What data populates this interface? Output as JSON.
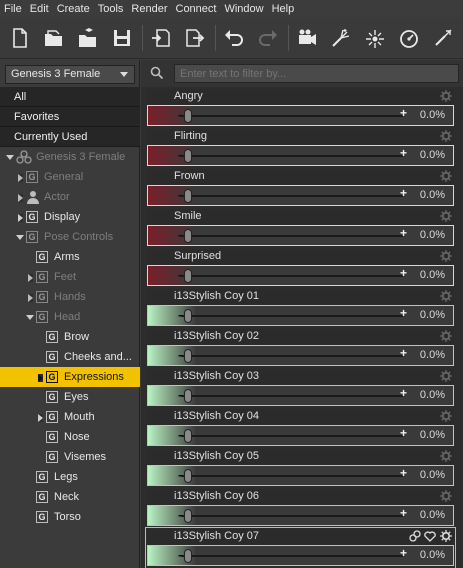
{
  "menu": [
    "File",
    "Edit",
    "Create",
    "Tools",
    "Render",
    "Connect",
    "Window",
    "Help"
  ],
  "toolbar": [
    {
      "name": "new-file-icon"
    },
    {
      "name": "open-folder-icon"
    },
    {
      "name": "merge-folder-icon"
    },
    {
      "name": "save-icon"
    },
    {
      "name": "import-icon"
    },
    {
      "name": "export-icon"
    },
    {
      "name": "undo-icon"
    },
    {
      "name": "redo-icon"
    },
    {
      "name": "camera-icon"
    },
    {
      "name": "spotlight-icon"
    },
    {
      "name": "point-light-icon"
    },
    {
      "name": "render-icon"
    },
    {
      "name": "render-settings-icon"
    }
  ],
  "left": {
    "figure_select": "Genesis 3 Female",
    "quick": [
      "All",
      "Favorites",
      "Currently Used"
    ],
    "tree": [
      {
        "label": "Genesis 3 Female",
        "indent": 0,
        "tw": "down",
        "icon": "figure",
        "dim": true
      },
      {
        "label": "General",
        "indent": 1,
        "tw": "right",
        "icon": "g",
        "dim": true
      },
      {
        "label": "Actor",
        "indent": 1,
        "tw": "right",
        "icon": "person",
        "dim": true
      },
      {
        "label": "Display",
        "indent": 1,
        "tw": "right",
        "icon": "g",
        "dim": false
      },
      {
        "label": "Pose Controls",
        "indent": 1,
        "tw": "down",
        "icon": "g",
        "dim": true
      },
      {
        "label": "Arms",
        "indent": 2,
        "tw": "",
        "icon": "g",
        "dim": false
      },
      {
        "label": "Feet",
        "indent": 2,
        "tw": "right",
        "icon": "g",
        "dim": true
      },
      {
        "label": "Hands",
        "indent": 2,
        "tw": "right",
        "icon": "g",
        "dim": true
      },
      {
        "label": "Head",
        "indent": 2,
        "tw": "down",
        "icon": "g",
        "dim": true
      },
      {
        "label": "Brow",
        "indent": 3,
        "tw": "",
        "icon": "g",
        "dim": false
      },
      {
        "label": "Cheeks and...",
        "indent": 3,
        "tw": "",
        "icon": "g",
        "dim": false
      },
      {
        "label": "Expressions",
        "indent": 3,
        "tw": "right",
        "icon": "g",
        "dim": false,
        "selected": true
      },
      {
        "label": "Eyes",
        "indent": 3,
        "tw": "",
        "icon": "g",
        "dim": false
      },
      {
        "label": "Mouth",
        "indent": 3,
        "tw": "right",
        "icon": "g",
        "dim": false
      },
      {
        "label": "Nose",
        "indent": 3,
        "tw": "",
        "icon": "g",
        "dim": false
      },
      {
        "label": "Visemes",
        "indent": 3,
        "tw": "",
        "icon": "g",
        "dim": false
      },
      {
        "label": "Legs",
        "indent": 2,
        "tw": "",
        "icon": "g",
        "dim": false
      },
      {
        "label": "Neck",
        "indent": 2,
        "tw": "",
        "icon": "g",
        "dim": false
      },
      {
        "label": "Torso",
        "indent": 2,
        "tw": "",
        "icon": "g",
        "dim": false
      }
    ],
    "g_glyph": "G"
  },
  "filter": {
    "placeholder": "Enter text to filter by..."
  },
  "sliders": [
    {
      "name": "Angry",
      "value": "0.0%",
      "kind": "red"
    },
    {
      "name": "Flirting",
      "value": "0.0%",
      "kind": "red"
    },
    {
      "name": "Frown",
      "value": "0.0%",
      "kind": "red"
    },
    {
      "name": "Smile",
      "value": "0.0%",
      "kind": "red"
    },
    {
      "name": "Surprised",
      "value": "0.0%",
      "kind": "red"
    },
    {
      "name": "i13Stylish Coy 01",
      "value": "0.0%",
      "kind": "green"
    },
    {
      "name": "i13Stylish Coy 02",
      "value": "0.0%",
      "kind": "green"
    },
    {
      "name": "i13Stylish Coy 03",
      "value": "0.0%",
      "kind": "green"
    },
    {
      "name": "i13Stylish Coy 04",
      "value": "0.0%",
      "kind": "green"
    },
    {
      "name": "i13Stylish Coy 05",
      "value": "0.0%",
      "kind": "green"
    },
    {
      "name": "i13Stylish Coy 06",
      "value": "0.0%",
      "kind": "green"
    },
    {
      "name": "i13Stylish Coy 07",
      "value": "0.0%",
      "kind": "green",
      "active": true
    }
  ],
  "slider_glyphs": {
    "minus": "-",
    "plus": "+"
  },
  "colors": {
    "selection": "#f2c200",
    "red_fill": "#7a1f2a",
    "green_fill": "#b9f3c2",
    "green_border": "#7be3d6"
  }
}
